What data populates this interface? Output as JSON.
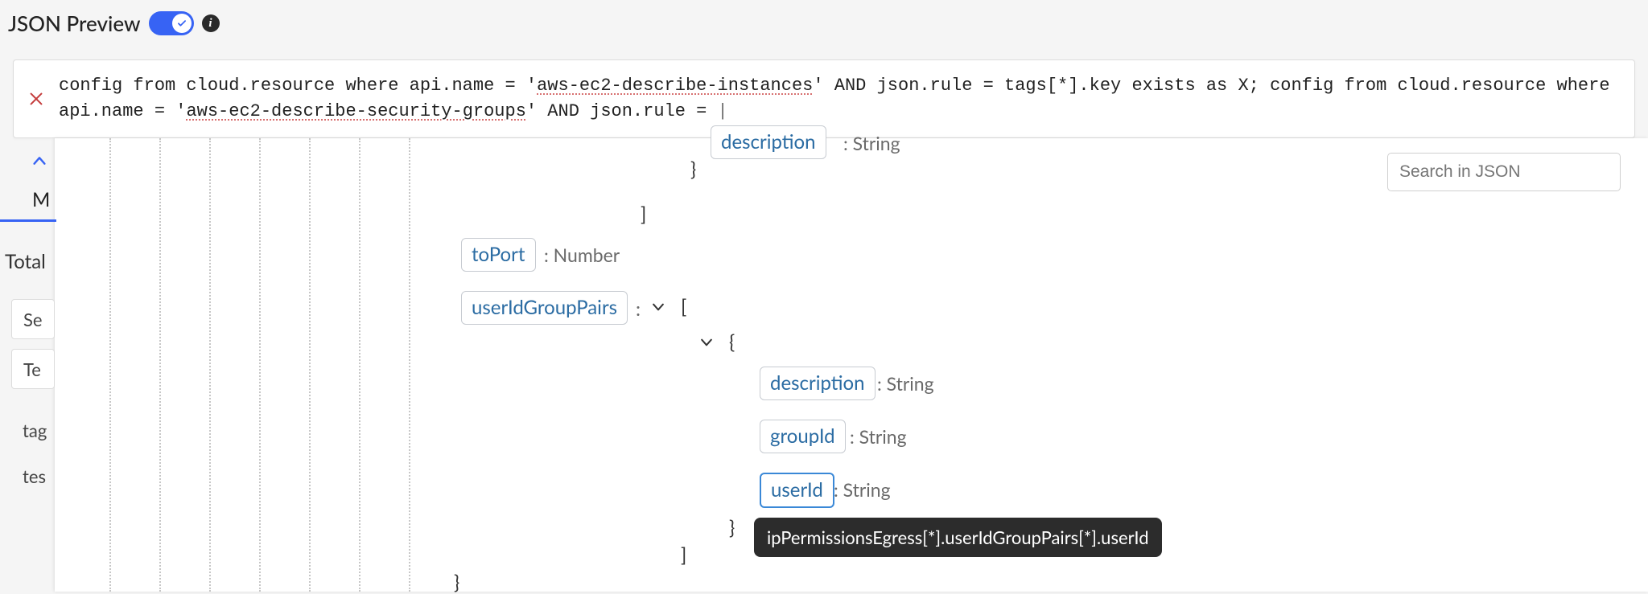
{
  "header": {
    "title": "JSON Preview",
    "toggle_on": true
  },
  "query": {
    "prefix1": "config from cloud.resource where api.name = ",
    "qstr1_open": "'",
    "qstr1": "aws-ec2-describe-instances",
    "qstr1_close": "'",
    "mid1": " AND json.rule = tags[*].key exists as X; config from cloud.resource where api.name = ",
    "qstr2_open": "'",
    "qstr2": "aws-ec2-describe-security-groups",
    "qstr2_close": "'",
    "suffix": " AND json.rule = ",
    "caret": "|"
  },
  "left": {
    "tab": "M",
    "total": "Total",
    "items": [
      "Se",
      "Te",
      "tag",
      "tes"
    ]
  },
  "json_tree": {
    "desc_token": "description",
    "desc_type": ": String",
    "brace_close1": "}",
    "bracket_close1": "]",
    "toPort": "toPort",
    "toPort_type": ": Number",
    "userIdGroupPairs": "userIdGroupPairs",
    "ugp_colon": ":",
    "ugp_open_bracket": "[",
    "ugp_open_brace": "{",
    "fields": [
      {
        "name": "description",
        "type": ": String"
      },
      {
        "name": "groupId",
        "type": ": String"
      },
      {
        "name": "userId",
        "type": ": String"
      }
    ],
    "ugp_close_brace": "}",
    "ugp_close_bracket": "]",
    "outer_close_brace": "}"
  },
  "search": {
    "placeholder": "Search in JSON"
  },
  "tooltip": {
    "text": "ipPermissionsEgress[*].userIdGroupPairs[*].userId"
  }
}
